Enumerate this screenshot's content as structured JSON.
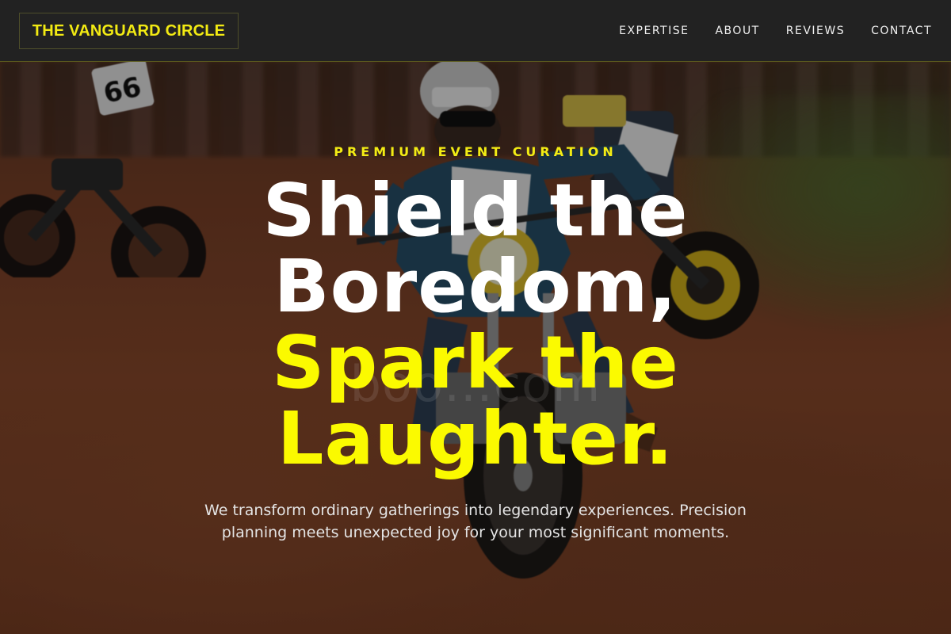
{
  "brand": {
    "name": "THE VANGUARD CIRCLE"
  },
  "nav": {
    "items": [
      {
        "label": "EXPERTISE"
      },
      {
        "label": "ABOUT"
      },
      {
        "label": "REVIEWS"
      },
      {
        "label": "CONTACT"
      }
    ]
  },
  "hero": {
    "eyebrow": "PREMIUM EVENT CURATION",
    "headline": {
      "line1": "Shield the",
      "line2": "Boredom,",
      "line3": "Spark the",
      "line4": "Laughter."
    },
    "subtext": "We transform ordinary gatherings into legendary experiences. Precision planning meets unexpected joy for your most significant moments.",
    "watermark": "boo…com",
    "image": "motorcycle-dirt-race-photo"
  },
  "colors": {
    "accent": "#f3ec14",
    "headline_yellow": "#fbfa00",
    "nav_bg": "#222222",
    "text_white": "#ffffff"
  }
}
